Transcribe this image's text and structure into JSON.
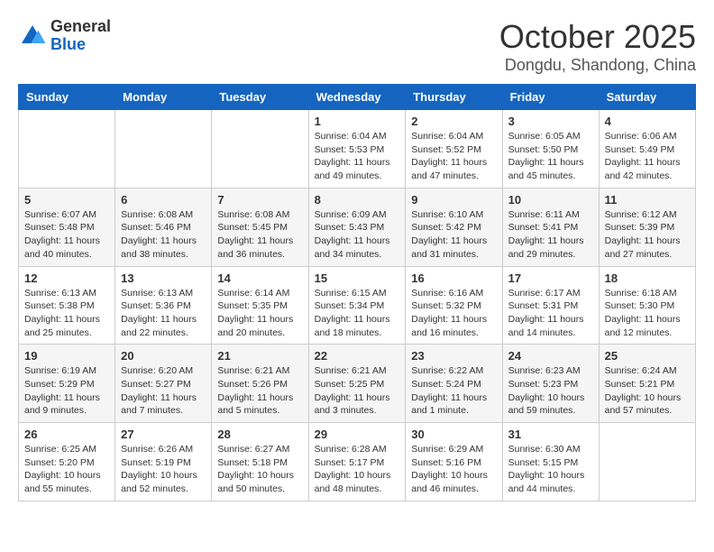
{
  "logo": {
    "general": "General",
    "blue": "Blue"
  },
  "title": "October 2025",
  "location": "Dongdu, Shandong, China",
  "weekdays": [
    "Sunday",
    "Monday",
    "Tuesday",
    "Wednesday",
    "Thursday",
    "Friday",
    "Saturday"
  ],
  "weeks": [
    [
      {
        "day": "",
        "info": ""
      },
      {
        "day": "",
        "info": ""
      },
      {
        "day": "",
        "info": ""
      },
      {
        "day": "1",
        "info": "Sunrise: 6:04 AM\nSunset: 5:53 PM\nDaylight: 11 hours\nand 49 minutes."
      },
      {
        "day": "2",
        "info": "Sunrise: 6:04 AM\nSunset: 5:52 PM\nDaylight: 11 hours\nand 47 minutes."
      },
      {
        "day": "3",
        "info": "Sunrise: 6:05 AM\nSunset: 5:50 PM\nDaylight: 11 hours\nand 45 minutes."
      },
      {
        "day": "4",
        "info": "Sunrise: 6:06 AM\nSunset: 5:49 PM\nDaylight: 11 hours\nand 42 minutes."
      }
    ],
    [
      {
        "day": "5",
        "info": "Sunrise: 6:07 AM\nSunset: 5:48 PM\nDaylight: 11 hours\nand 40 minutes."
      },
      {
        "day": "6",
        "info": "Sunrise: 6:08 AM\nSunset: 5:46 PM\nDaylight: 11 hours\nand 38 minutes."
      },
      {
        "day": "7",
        "info": "Sunrise: 6:08 AM\nSunset: 5:45 PM\nDaylight: 11 hours\nand 36 minutes."
      },
      {
        "day": "8",
        "info": "Sunrise: 6:09 AM\nSunset: 5:43 PM\nDaylight: 11 hours\nand 34 minutes."
      },
      {
        "day": "9",
        "info": "Sunrise: 6:10 AM\nSunset: 5:42 PM\nDaylight: 11 hours\nand 31 minutes."
      },
      {
        "day": "10",
        "info": "Sunrise: 6:11 AM\nSunset: 5:41 PM\nDaylight: 11 hours\nand 29 minutes."
      },
      {
        "day": "11",
        "info": "Sunrise: 6:12 AM\nSunset: 5:39 PM\nDaylight: 11 hours\nand 27 minutes."
      }
    ],
    [
      {
        "day": "12",
        "info": "Sunrise: 6:13 AM\nSunset: 5:38 PM\nDaylight: 11 hours\nand 25 minutes."
      },
      {
        "day": "13",
        "info": "Sunrise: 6:13 AM\nSunset: 5:36 PM\nDaylight: 11 hours\nand 22 minutes."
      },
      {
        "day": "14",
        "info": "Sunrise: 6:14 AM\nSunset: 5:35 PM\nDaylight: 11 hours\nand 20 minutes."
      },
      {
        "day": "15",
        "info": "Sunrise: 6:15 AM\nSunset: 5:34 PM\nDaylight: 11 hours\nand 18 minutes."
      },
      {
        "day": "16",
        "info": "Sunrise: 6:16 AM\nSunset: 5:32 PM\nDaylight: 11 hours\nand 16 minutes."
      },
      {
        "day": "17",
        "info": "Sunrise: 6:17 AM\nSunset: 5:31 PM\nDaylight: 11 hours\nand 14 minutes."
      },
      {
        "day": "18",
        "info": "Sunrise: 6:18 AM\nSunset: 5:30 PM\nDaylight: 11 hours\nand 12 minutes."
      }
    ],
    [
      {
        "day": "19",
        "info": "Sunrise: 6:19 AM\nSunset: 5:29 PM\nDaylight: 11 hours\nand 9 minutes."
      },
      {
        "day": "20",
        "info": "Sunrise: 6:20 AM\nSunset: 5:27 PM\nDaylight: 11 hours\nand 7 minutes."
      },
      {
        "day": "21",
        "info": "Sunrise: 6:21 AM\nSunset: 5:26 PM\nDaylight: 11 hours\nand 5 minutes."
      },
      {
        "day": "22",
        "info": "Sunrise: 6:21 AM\nSunset: 5:25 PM\nDaylight: 11 hours\nand 3 minutes."
      },
      {
        "day": "23",
        "info": "Sunrise: 6:22 AM\nSunset: 5:24 PM\nDaylight: 11 hours\nand 1 minute."
      },
      {
        "day": "24",
        "info": "Sunrise: 6:23 AM\nSunset: 5:23 PM\nDaylight: 10 hours\nand 59 minutes."
      },
      {
        "day": "25",
        "info": "Sunrise: 6:24 AM\nSunset: 5:21 PM\nDaylight: 10 hours\nand 57 minutes."
      }
    ],
    [
      {
        "day": "26",
        "info": "Sunrise: 6:25 AM\nSunset: 5:20 PM\nDaylight: 10 hours\nand 55 minutes."
      },
      {
        "day": "27",
        "info": "Sunrise: 6:26 AM\nSunset: 5:19 PM\nDaylight: 10 hours\nand 52 minutes."
      },
      {
        "day": "28",
        "info": "Sunrise: 6:27 AM\nSunset: 5:18 PM\nDaylight: 10 hours\nand 50 minutes."
      },
      {
        "day": "29",
        "info": "Sunrise: 6:28 AM\nSunset: 5:17 PM\nDaylight: 10 hours\nand 48 minutes."
      },
      {
        "day": "30",
        "info": "Sunrise: 6:29 AM\nSunset: 5:16 PM\nDaylight: 10 hours\nand 46 minutes."
      },
      {
        "day": "31",
        "info": "Sunrise: 6:30 AM\nSunset: 5:15 PM\nDaylight: 10 hours\nand 44 minutes."
      },
      {
        "day": "",
        "info": ""
      }
    ]
  ]
}
